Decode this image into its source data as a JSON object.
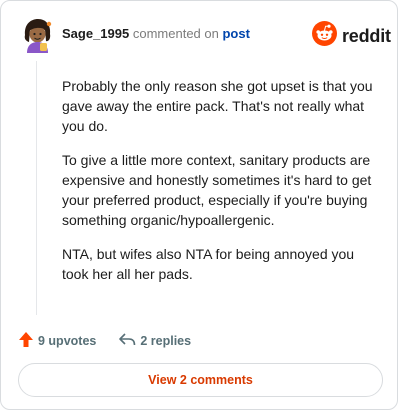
{
  "header": {
    "username": "Sage_1995",
    "commented_on": "commented on",
    "post_link": "post"
  },
  "brand": {
    "name": "reddit",
    "color": "#ff4500"
  },
  "comment": {
    "paragraphs": [
      "Probably the only reason she got upset is that you gave away the entire pack. That's not really what you do.",
      "To give a little more context, sanitary products are expensive and honestly sometimes it's hard to get your preferred product, especially if you're buying something organic/hypoallergenic.",
      "NTA, but wifes also NTA for being annoyed you took her all her pads."
    ]
  },
  "actions": {
    "upvotes": "9 upvotes",
    "replies": "2 replies"
  },
  "footer": {
    "view_comments": "View 2 comments"
  },
  "colors": {
    "upvote_arrow": "#ff4500",
    "view_button_text": "#d93a00",
    "post_link": "#0045ac"
  },
  "icons": [
    "avatar",
    "reddit-snoo-icon",
    "upvote-arrow-icon",
    "reply-arrow-icon"
  ]
}
